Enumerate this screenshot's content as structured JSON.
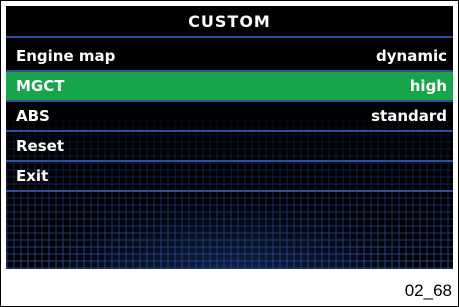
{
  "screen": {
    "title": "CUSTOM",
    "menu": [
      {
        "label": "Engine map",
        "value": "dynamic",
        "selected": false
      },
      {
        "label": "MGCT",
        "value": "high",
        "selected": true
      },
      {
        "label": "ABS",
        "value": "standard",
        "selected": false
      },
      {
        "label": "Reset",
        "value": "",
        "selected": false
      },
      {
        "label": "Exit",
        "value": "",
        "selected": false
      }
    ]
  },
  "caption": "02_68",
  "colors": {
    "selected_row": "#17a44a",
    "divider": "#2d4f9e",
    "background": "#000000"
  }
}
